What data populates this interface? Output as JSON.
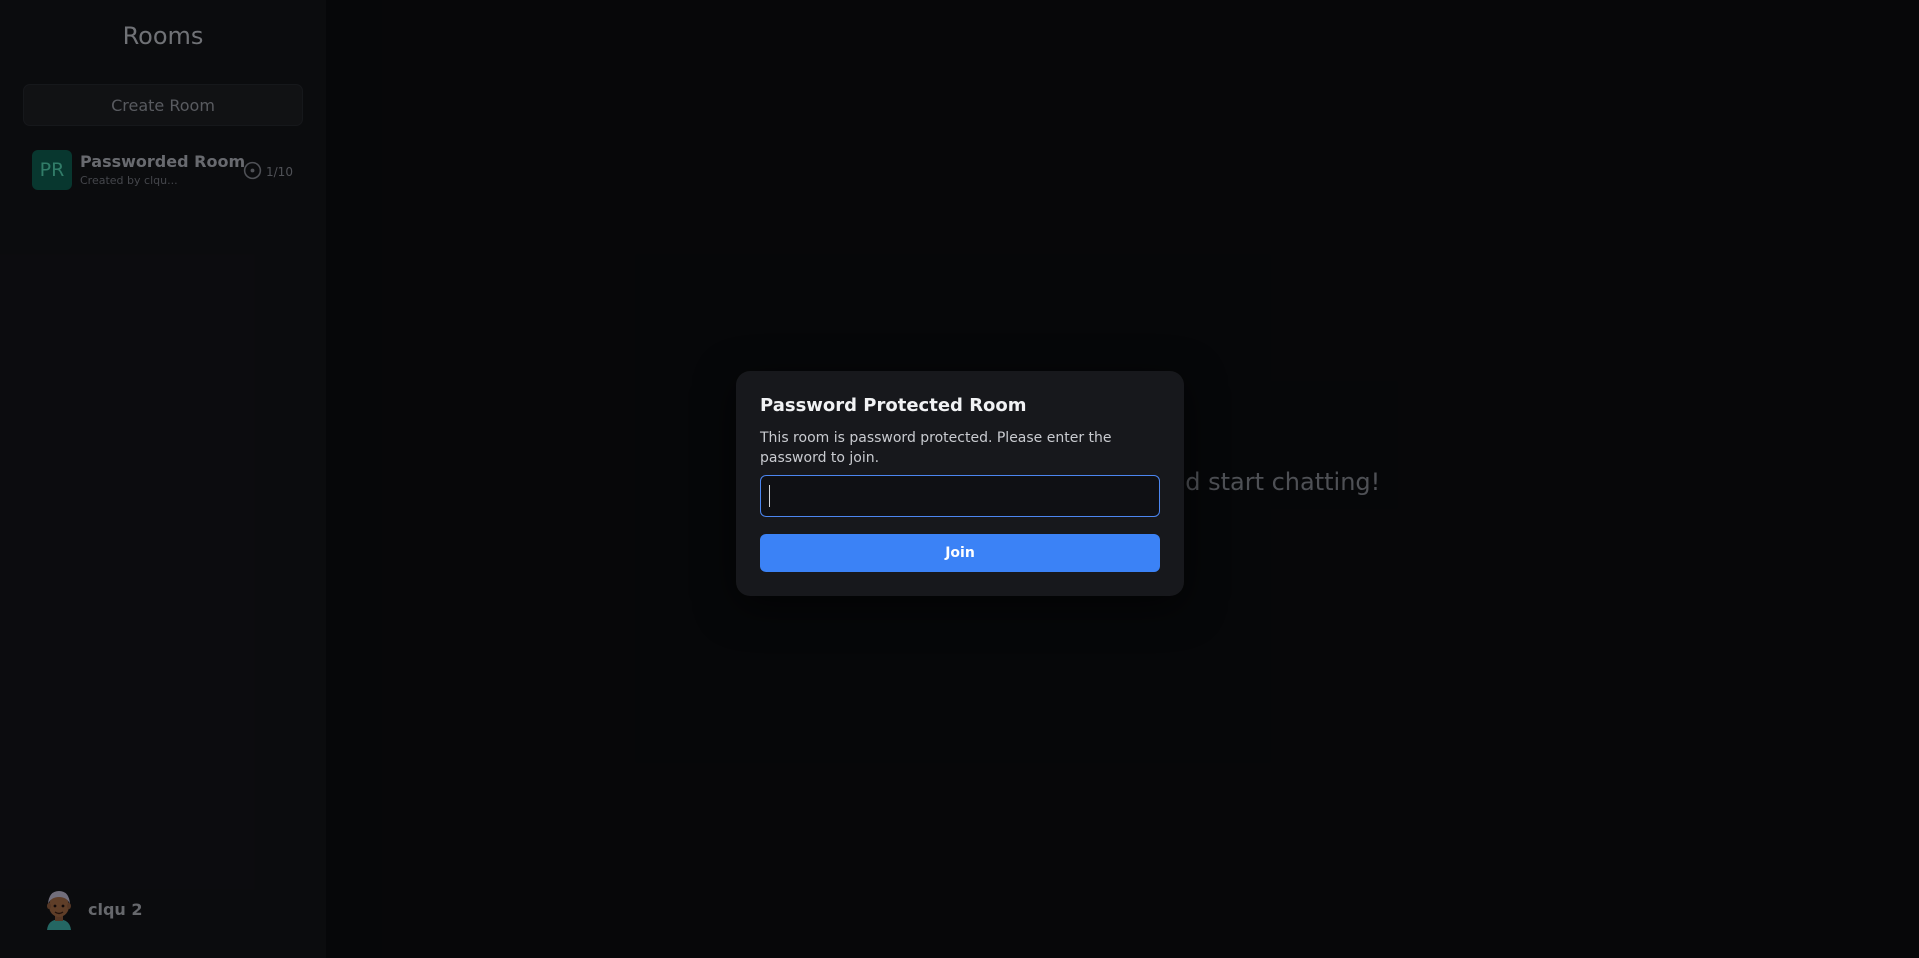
{
  "sidebar": {
    "title": "Rooms",
    "create_room_label": "Create Room",
    "rooms": [
      {
        "initials": "PR",
        "name": "Passworded Room",
        "creator": "Created by clqu...",
        "occupancy": "1/10",
        "avatar_color": "#0e5a4d"
      }
    ],
    "user": {
      "name": "clqu 2",
      "avatar_icon": "memoji-avatar"
    }
  },
  "main": {
    "message": "nd start chatting!"
  },
  "modal": {
    "title": "Password Protected Room",
    "description": "This room is password protected. Please enter the password to join.",
    "password_value": "",
    "join_label": "Join"
  },
  "colors": {
    "accent": "#3b82f6",
    "background": "#0b0c0f",
    "sidebar": "#131418"
  }
}
